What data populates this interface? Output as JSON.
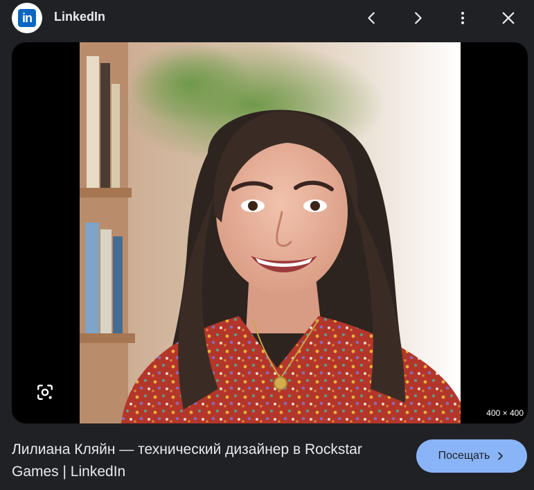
{
  "header": {
    "site_logo_text": "in",
    "site_name": "LinkedIn",
    "icons": {
      "prev": "chevron-left-icon",
      "next": "chevron-right-icon",
      "more": "more-vert-icon",
      "close": "close-icon"
    }
  },
  "image": {
    "dimensions": "400 × 400",
    "lens_icon": "google-lens-icon"
  },
  "result": {
    "title": "Лилиана Кляйн — технический дизайнер в Rockstar Games | LinkedIn",
    "visit_label": "Посещать"
  },
  "colors": {
    "background": "#202124",
    "accent_button": "#8ab4f8",
    "linkedin_blue": "#0a66c2"
  }
}
